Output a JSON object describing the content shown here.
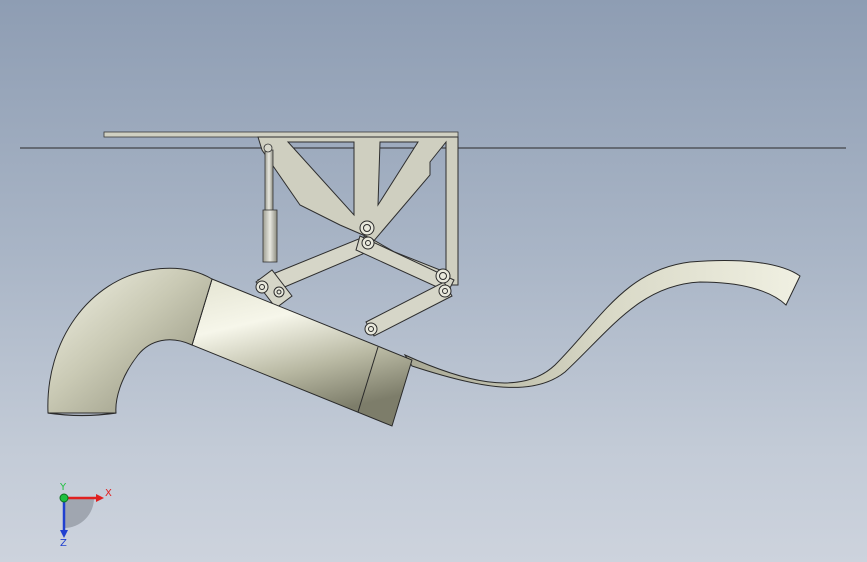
{
  "viewport": {
    "background_top": "#8e9db3",
    "background_bottom": "#cdd3dd"
  },
  "model": {
    "parts": [
      "water-surface-line",
      "bracket-frame",
      "hydraulic-cylinder",
      "linkage-arms",
      "pivot-pins",
      "bent-pipe",
      "straight-pipe",
      "curved-blade"
    ]
  },
  "triad": {
    "x_label": "X",
    "y_label": "Y",
    "z_label": "Z",
    "x_color": "#e02020",
    "y_color": "#20c040",
    "z_color": "#2040d0"
  }
}
